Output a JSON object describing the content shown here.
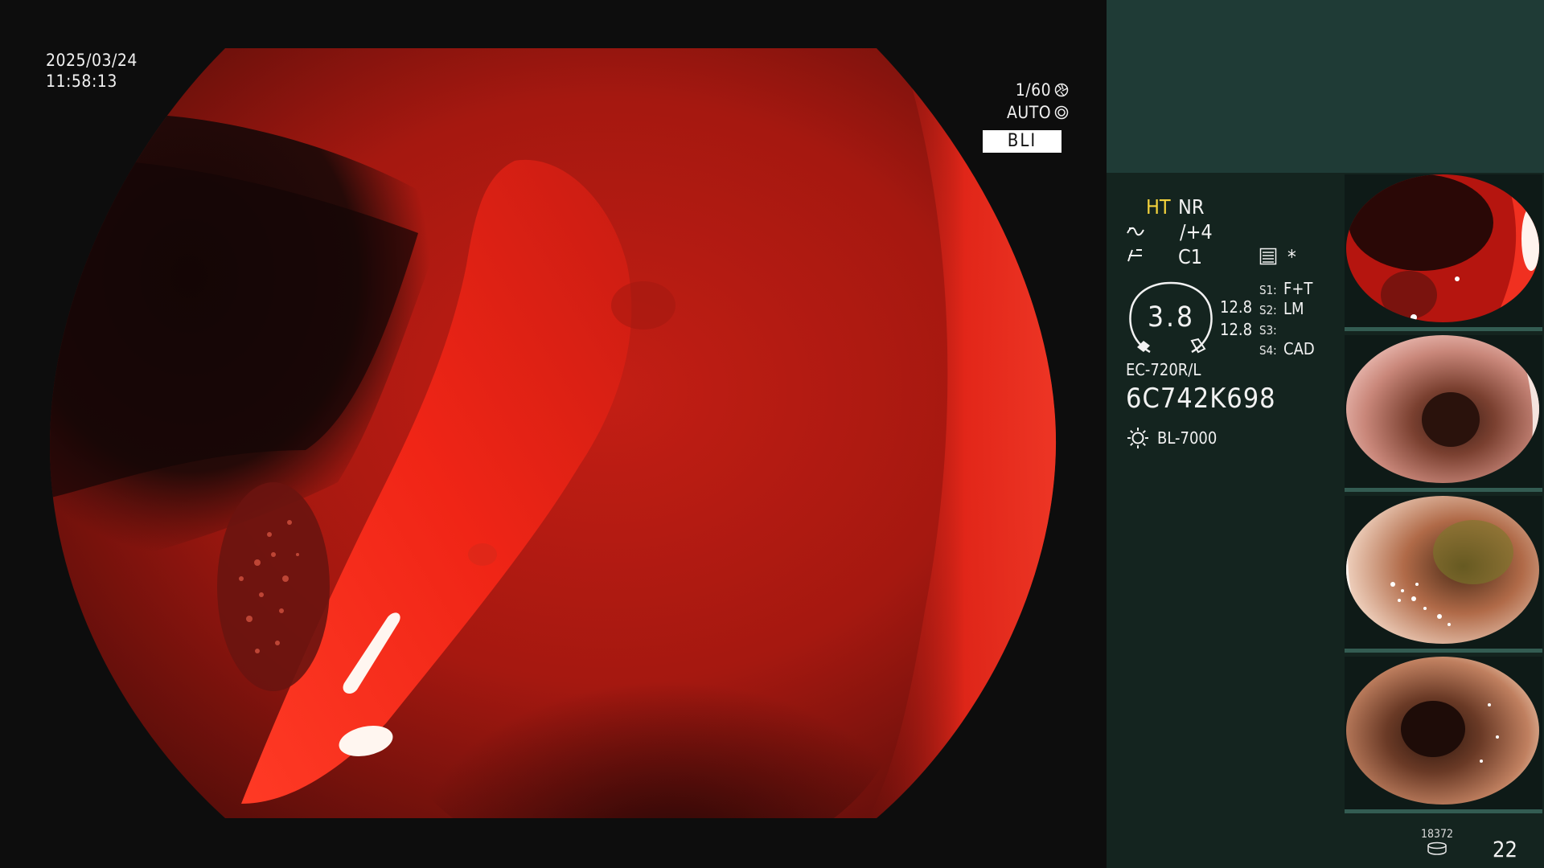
{
  "overlay": {
    "date": "2025/03/24",
    "time": "11:58:13",
    "shutter": "1/60",
    "exposure": "AUTO",
    "mode": "BLI"
  },
  "panel": {
    "structure_enh": "HT",
    "noise_reduction": "NR",
    "enhancement_level": "/+4",
    "color_mode": "C1",
    "star": "*",
    "zoom": "3.8",
    "magnification_1": "12.8",
    "magnification_2": "12.8",
    "switches": [
      {
        "label": "S1:",
        "value": "F+T"
      },
      {
        "label": "S2:",
        "value": "LM"
      },
      {
        "label": "S3:",
        "value": ""
      },
      {
        "label": "S4:",
        "value": "CAD"
      }
    ],
    "scope_model": "EC-720R/L",
    "serial": "6C742K698",
    "light_source": "BL-7000",
    "image_count": "18372",
    "frame_number": "22"
  },
  "icons": {
    "shutter": "aperture-icon",
    "exposure": "iris-icon",
    "enhancement": "enhancement-curve-icon",
    "color": "color-curve-icon",
    "menu": "settings-list-icon",
    "light": "light-source-icon",
    "counter": "storage-stack-icon"
  },
  "colors": {
    "panel_top": "#1f3b36",
    "panel": "#14241f",
    "highlight": "#f3d23c",
    "mode_badge": "#ffffff"
  },
  "thumbnails": [
    {
      "name": "thumb-bli-red"
    },
    {
      "name": "thumb-lumen-pink"
    },
    {
      "name": "thumb-lumen-mucosa"
    },
    {
      "name": "thumb-lumen-brown"
    }
  ]
}
